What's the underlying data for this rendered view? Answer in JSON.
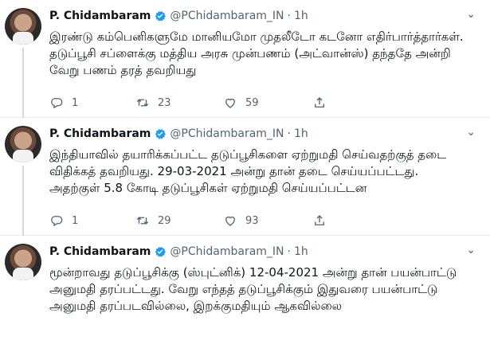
{
  "tweets": [
    {
      "name": "P. Chidambaram",
      "handle": "@PChidambaram_IN",
      "dot": "·",
      "time": "1h",
      "text": "இரண்டு கம்பெனிகளுமே மானியமோ முதலீடோ கடனோ எதிர்பார்த்தார்கள். தடுப்பூசி சப்ளைக்கு மத்திய அரசு முன்பணம் (அட்வான்ஸ்) தந்ததே அன்றி வேறு பணம் தரத் தவறியது",
      "replies": "1",
      "retweets": "23",
      "likes": "59"
    },
    {
      "name": "P. Chidambaram",
      "handle": "@PChidambaram_IN",
      "dot": "·",
      "time": "1h",
      "text": "இந்தியாவில் தயாரிக்கப்பட்ட தடுப்பூசிகளை ஏற்றுமதி செய்வதற்குத் தடை விதிக்கத் தவறியது. 29-03-2021 அன்று தான் தடை செய்யப்பட்டது. அதற்குள் 5.8 கோடி தடுப்பூசிகள் ஏற்றுமதி செய்யப்பட்டன",
      "replies": "1",
      "retweets": "29",
      "likes": "93"
    },
    {
      "name": "P. Chidambaram",
      "handle": "@PChidambaram_IN",
      "dot": "·",
      "time": "1h",
      "text": "மூன்றாவது தடுப்பூசிக்கு (ஸ்புட்னிக்) 12-04-2021 அன்று தான் பயன்பாட்டு அனுமதி தரப்பட்டது. வேறு எந்தத் தடுப்பூசிக்கும் இதுவரை பயன்பாட்டு அனுமதி தரப்படவில்லை, இறக்குமதியும் ஆகவில்லை",
      "replies": "",
      "retweets": "",
      "likes": ""
    }
  ],
  "icons": {
    "verified": "verified-badge-icon",
    "more": "chevron-down-icon",
    "reply": "reply-icon",
    "retweet": "retweet-icon",
    "like": "heart-icon",
    "share": "share-icon"
  },
  "colors": {
    "verified": "#1d9bf0",
    "secondary_text": "#536471",
    "primary_text": "#0f1419",
    "divider": "#e6ecf0",
    "thread_line": "#cfd9de"
  }
}
